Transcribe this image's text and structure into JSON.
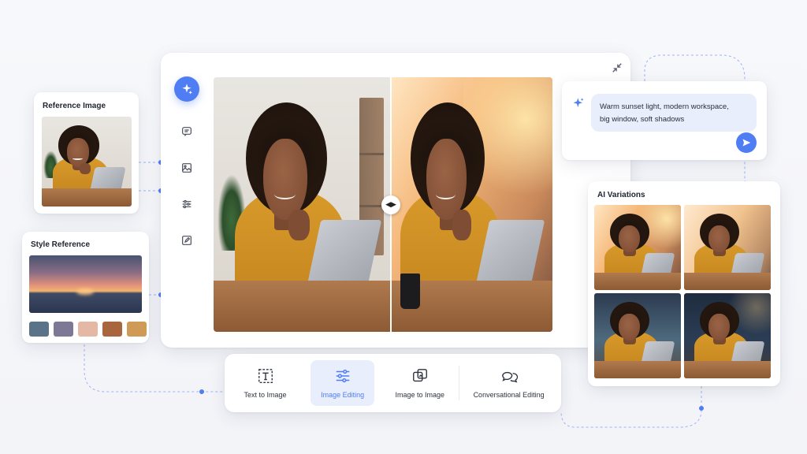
{
  "reference_card": {
    "title": "Reference Image"
  },
  "style_card": {
    "title": "Style Reference",
    "palette": [
      "#5a7389",
      "#7d7896",
      "#e4b8a4",
      "#a9653d",
      "#cf9a55"
    ]
  },
  "editor": {
    "rail": [
      {
        "name": "sparkle-icon",
        "active": true
      },
      {
        "name": "chat-icon"
      },
      {
        "name": "image-icon"
      },
      {
        "name": "sliders-icon"
      },
      {
        "name": "edit-icon"
      }
    ],
    "compare_handle": "◀▶",
    "collapse_icon": "collapse-icon"
  },
  "prompt": {
    "line1": "Warm sunset light, modern workspace,",
    "line2": "big window, soft shadows"
  },
  "variations": {
    "title": "AI Variations"
  },
  "modes": [
    {
      "label": "Text to Image",
      "icon": "text-frame-icon",
      "active": false
    },
    {
      "label": "Image Editing",
      "icon": "sliders-icon",
      "active": true
    },
    {
      "label": "Image to Image",
      "icon": "image-stack-icon",
      "active": false
    },
    {
      "label": "Conversational Editing",
      "icon": "chat-bubbles-icon",
      "active": false
    }
  ],
  "colors": {
    "accent": "#4f7df3",
    "accent_bg": "#e9eefc",
    "connector": "#7f9cf5"
  }
}
